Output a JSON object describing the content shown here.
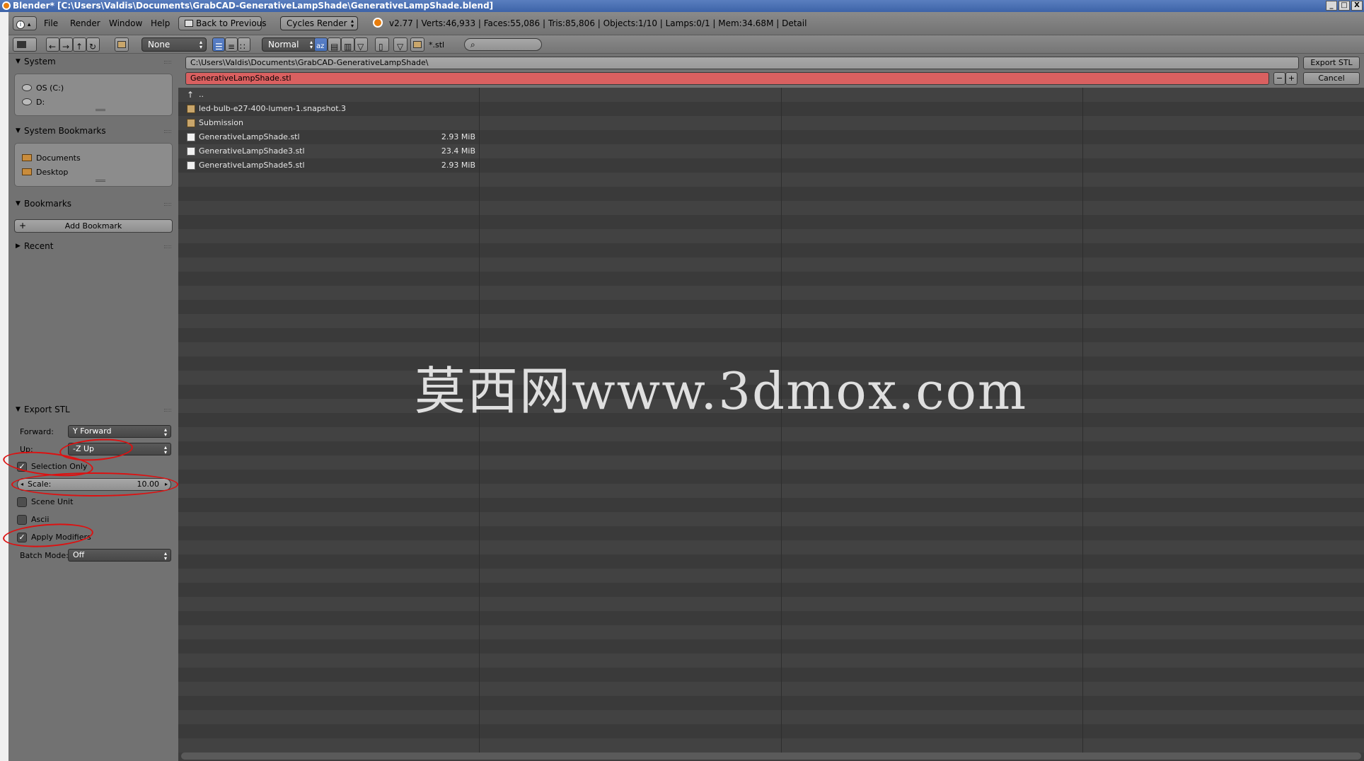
{
  "window": {
    "title": "Blender* [C:\\Users\\Valdis\\Documents\\GrabCAD-GenerativeLampShade\\GenerativeLampShade.blend]",
    "controls": [
      "_",
      "□",
      "X"
    ]
  },
  "menu": {
    "items": [
      "File",
      "Render",
      "Window",
      "Help"
    ],
    "back_button": "Back to Previous",
    "render_engine": "Cycles Render",
    "stats": "v2.77 | Verts:46,933 | Faces:55,086 | Tris:85,806 | Objects:1/10 | Lamps:0/1 | Mem:34.68M | Detail"
  },
  "toolbar": {
    "recursion": "None",
    "display_mode": "Normal",
    "filter_text": "*.stl",
    "search_placeholder": ""
  },
  "sidebar": {
    "system_header": "System",
    "system_items": [
      "OS (C:)",
      "D:"
    ],
    "system_bookmarks_header": "System Bookmarks",
    "system_bookmarks_items": [
      "Documents",
      "Desktop"
    ],
    "bookmarks_header": "Bookmarks",
    "add_bookmark_label": "Add Bookmark",
    "recent_header": "Recent"
  },
  "export_stl": {
    "header": "Export STL",
    "forward_label": "Forward:",
    "forward_value": "Y Forward",
    "up_label": "Up:",
    "up_value": "-Z Up",
    "selection_only_label": "Selection Only",
    "selection_only_checked": true,
    "scale_label": "Scale:",
    "scale_value": "10.00",
    "scene_unit_label": "Scene Unit",
    "scene_unit_checked": false,
    "ascii_label": "Ascii",
    "ascii_checked": false,
    "apply_modifiers_label": "Apply Modifiers",
    "apply_modifiers_checked": true,
    "batch_mode_label": "Batch Mode:",
    "batch_mode_value": "Off"
  },
  "file_browser": {
    "directory": "C:\\Users\\Valdis\\Documents\\GrabCAD-GenerativeLampShade\\",
    "filename": "GenerativeLampShade.stl",
    "export_button": "Export STL",
    "cancel_button": "Cancel",
    "parent_label": "..",
    "entries": [
      {
        "name": "led-bulb-e27-400-lumen-1.snapshot.3",
        "type": "folder",
        "size": ""
      },
      {
        "name": "Submission",
        "type": "folder",
        "size": ""
      },
      {
        "name": "GenerativeLampShade.stl",
        "type": "file",
        "size": "2.93 MiB"
      },
      {
        "name": "GenerativeLampShade3.stl",
        "type": "file",
        "size": "23.4 MiB"
      },
      {
        "name": "GenerativeLampShade5.stl",
        "type": "file",
        "size": "2.93 MiB"
      }
    ]
  },
  "watermark": "莫西网www.3dmox.com",
  "colors": {
    "filename_highlight": "#d96060",
    "annotation_red": "#dd1111",
    "active_blue": "#4f78c0"
  }
}
